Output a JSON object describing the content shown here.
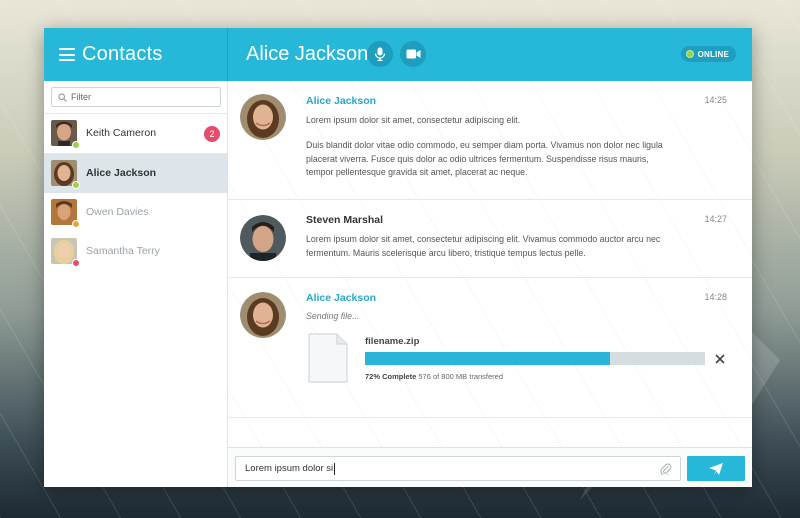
{
  "sidebar": {
    "title": "Contacts",
    "filter_placeholder": "Filter",
    "contacts": [
      {
        "name": "Keith Cameron",
        "status": "online",
        "unread": "2"
      },
      {
        "name": "Alice Jackson",
        "status": "online",
        "active": true
      },
      {
        "name": "Owen Davies",
        "status": "away"
      },
      {
        "name": "Samantha Terry",
        "status": "busy"
      }
    ]
  },
  "chat": {
    "title": "Alice Jackson",
    "status": "ONLINE",
    "icons": {
      "mic": "microphone-icon",
      "video": "video-camera-icon"
    }
  },
  "messages": [
    {
      "sender": "Alice Jackson",
      "time": "14:25",
      "lines": [
        "Lorem ipsum dolor sit amet, consectetur adipiscing elit.",
        "Duis blandit dolor vitae odio commodo, eu semper diam porta. Vivamus non dolor nec ligula placerat viverra. Fusce quis dolor ac odio ultrices fermentum. Suspendisse risus mauris, tempor pellentesque gravida sit amet, placerat ac neque."
      ]
    },
    {
      "sender": "Steven Marshal",
      "time": "14:27",
      "lines": [
        "Lorem ipsum dolor sit amet, consectetur adipiscing elit. Vivamus commodo auctor arcu nec fermentum. Mauris scelerisque arcu libero, tristique tempus lectus pelle."
      ]
    },
    {
      "sender": "Alice Jackson",
      "time": "14:28",
      "status_text": "Sending file...",
      "file": {
        "name": "filename.zip",
        "progress_percent": 72,
        "progress_label": "72% Complete",
        "progress_detail": "576 of 800 MB transfered"
      }
    }
  ],
  "composer": {
    "value": "Lorem ipsum dolor si",
    "icons": {
      "attach": "paperclip-icon",
      "send": "send-icon"
    }
  },
  "colors": {
    "accent": "#26b7d9",
    "online": "#9bd14a",
    "away": "#e8a53a",
    "busy": "#e44d6c",
    "badge": "#e44d6c"
  }
}
